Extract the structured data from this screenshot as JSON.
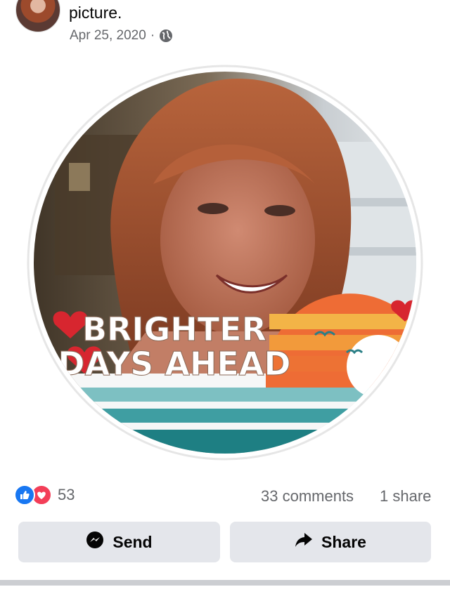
{
  "post": {
    "text_tail": "picture.",
    "date": "Apr 25, 2020",
    "separator": "·",
    "privacy_icon": "globe-icon"
  },
  "photo": {
    "frame_text_line1": "BRIGHTER",
    "frame_text_line2": "DAYS AHEAD"
  },
  "stats": {
    "reaction_icons": [
      "like-icon",
      "love-icon"
    ],
    "reaction_count": "53",
    "comments": "33 comments",
    "shares": "1 share"
  },
  "actions": {
    "send_label": "Send",
    "share_label": "Share"
  },
  "colors": {
    "button_bg": "#e4e6eb",
    "meta_text": "#65676b",
    "like_blue": "#1877f2",
    "love_red": "#f33e58"
  }
}
